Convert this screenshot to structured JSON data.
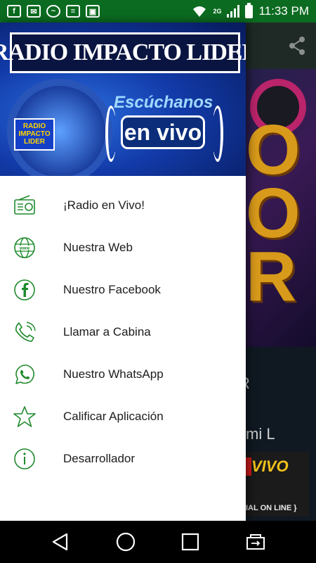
{
  "status_bar": {
    "time": "11:33 PM",
    "network": "2G",
    "bg_color": "#0b6b20",
    "left_icons": [
      "facebook-icon",
      "mail-icon",
      "messenger-icon",
      "message-icon",
      "photo-icon"
    ]
  },
  "header": {
    "title": "RADIO IMPACTO LIDER",
    "tagline": "Escúchanos",
    "live_badge": "en vivo",
    "logo_text": "RADIO IMPACTO LIDER"
  },
  "background": {
    "text_1": "R",
    "text_2": "mi L",
    "banner_text": "VIVO",
    "banner_subtext": "IAL ON LINE }"
  },
  "menu": {
    "accent_color": "#1f8a2c",
    "items": [
      {
        "label": "¡Radio en Vivo!",
        "icon": "radio-icon"
      },
      {
        "label": "Nuestra Web",
        "icon": "globe-www-icon"
      },
      {
        "label": "Nuestro Facebook",
        "icon": "facebook-icon"
      },
      {
        "label": "Llamar a Cabina",
        "icon": "phone-icon"
      },
      {
        "label": "Nuestro WhatsApp",
        "icon": "whatsapp-icon"
      },
      {
        "label": "Calificar Aplicación",
        "icon": "star-icon"
      },
      {
        "label": "Desarrollador",
        "icon": "info-icon"
      }
    ]
  },
  "nav_bar": {
    "buttons": [
      "back-icon",
      "home-icon",
      "recents-icon",
      "switch-icon"
    ]
  }
}
